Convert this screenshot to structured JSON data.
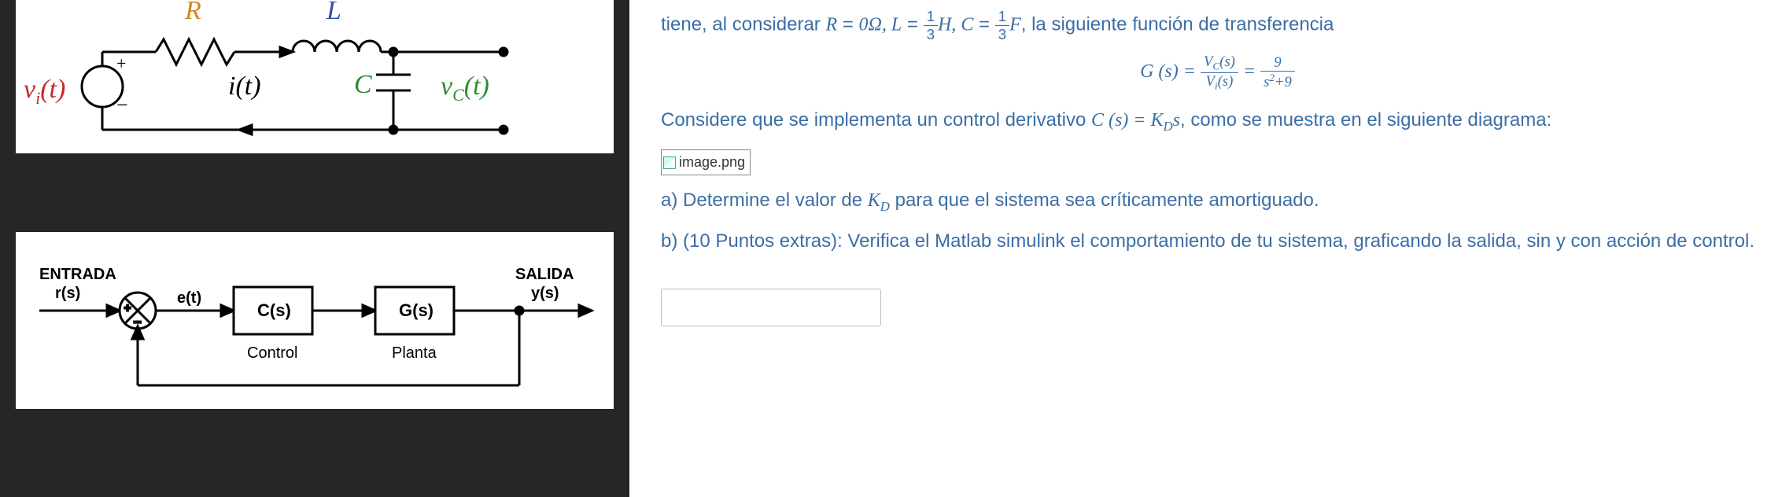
{
  "rlc": {
    "R": "R",
    "L": "L",
    "vi": "v",
    "vi_sub": "i",
    "vi_arg": "(t)",
    "i_t": "i(t)",
    "C": "C",
    "vc": "v",
    "vc_sub": "C",
    "vc_arg": "(t)"
  },
  "block": {
    "entrada": "ENTRADA",
    "r_s": "r(s)",
    "e_t": "e(t)",
    "c_s": "C(s)",
    "g_s": "G(s)",
    "control": "Control",
    "planta": "Planta",
    "salida": "SALIDA",
    "y_s": "y(s)"
  },
  "right": {
    "intro1": "tiene, al considerar ",
    "R_eq_lhs": "R",
    "R_eq_rhs": "0Ω, ",
    "L_eq_lhs": "L",
    "LC_num": "1",
    "LC_den": "3",
    "L_unit": "H, ",
    "C_eq_lhs": "C",
    "C_unit": "F",
    "intro2": ", la siguiente función de transferencia",
    "G_lhs": "G (s) = ",
    "G_num1": "V",
    "G_num1_sub": "C",
    "G_num1_arg": "(s)",
    "G_den1": "V",
    "G_den1_sub": "i",
    "G_den1_arg": "(s)",
    "G_num2": "9",
    "G_den2_a": "s",
    "G_den2_b": "+9",
    "consider": "Considere que se implementa un control derivativo ",
    "ctrl_eq_lhs": "C (s) = K",
    "ctrl_eq_sub": "D",
    "ctrl_eq_rhs": "s",
    "consider2": ", como se muestra en el siguiente diagrama:",
    "broken_label": "image.png",
    "a_prefix": "a) Determine el valor de ",
    "KD_K": "K",
    "KD_D": "D",
    "a_suffix": " para que el sistema sea críticamente amortiguado.",
    "b_text": "b) (10 Puntos extras): Verifica el Matlab simulink el comportamiento de tu sistema, graficando la salida, sin y con acción de control."
  },
  "equals": " = "
}
